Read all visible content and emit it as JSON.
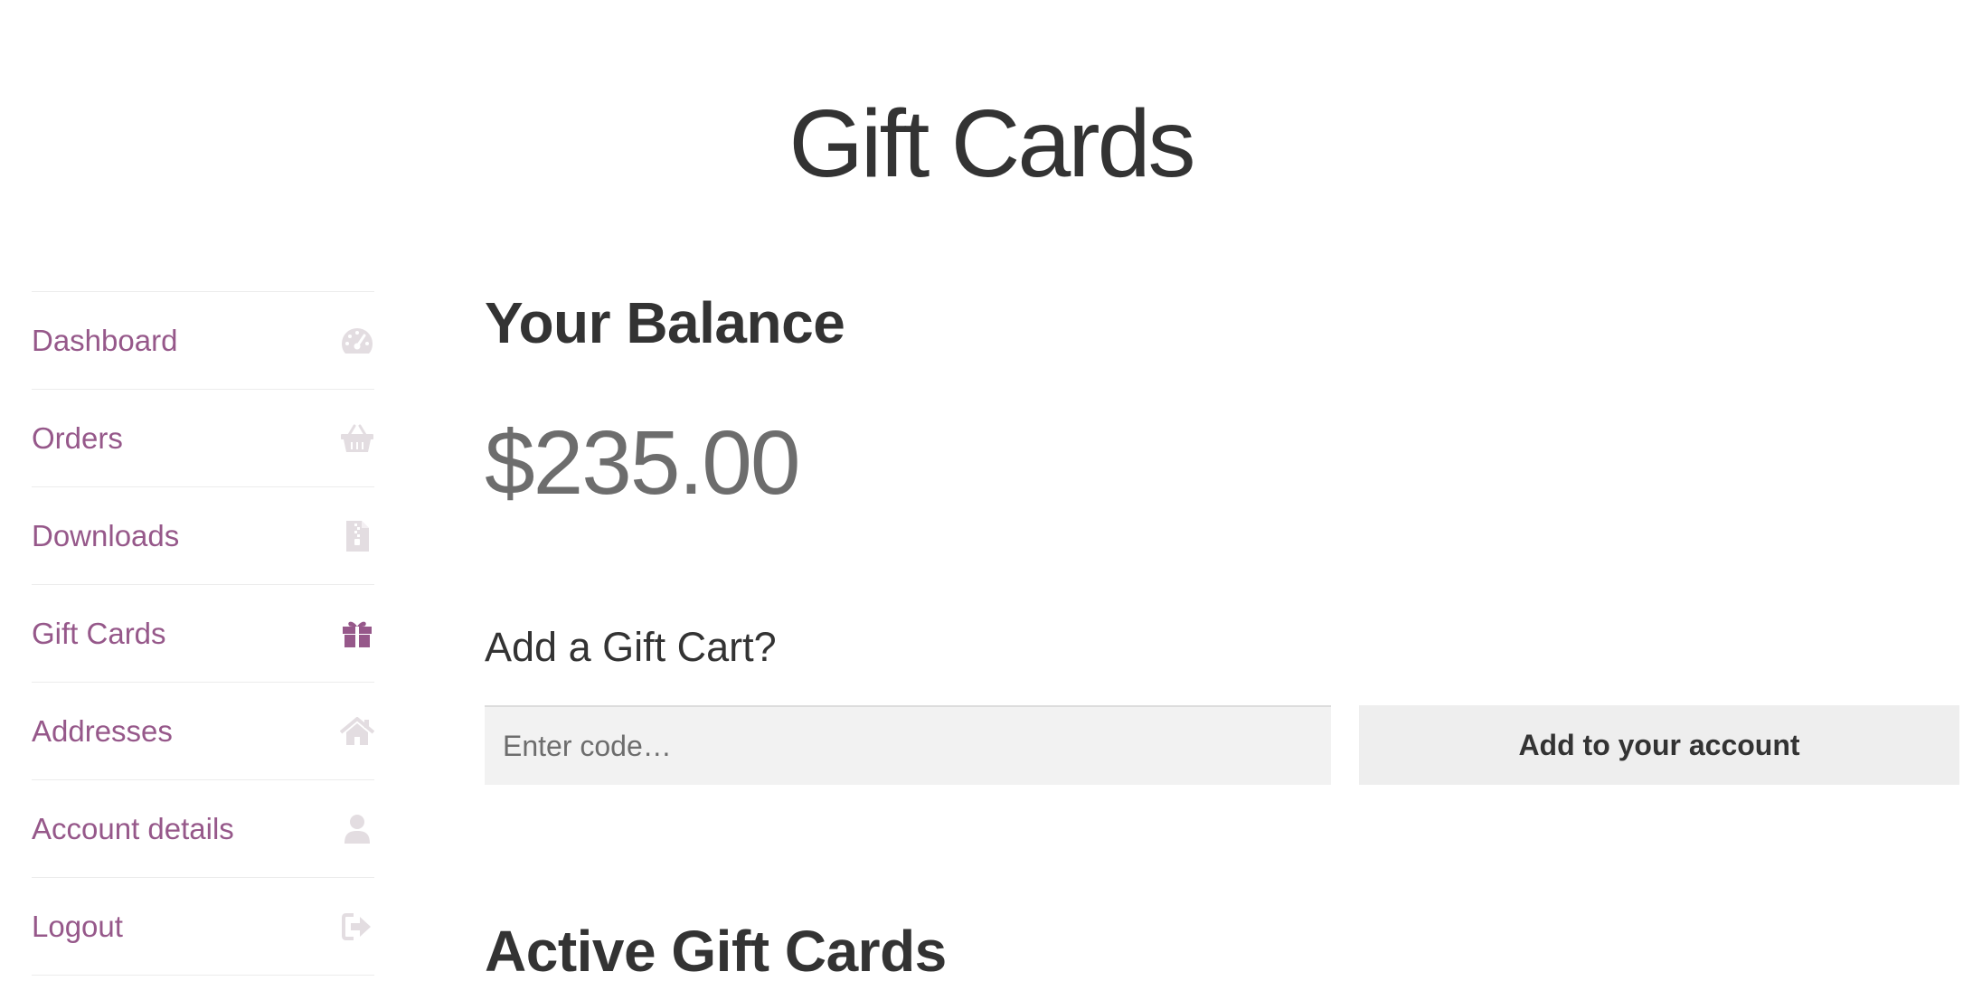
{
  "page": {
    "title": "Gift Cards"
  },
  "nav": {
    "items": [
      {
        "label": "Dashboard",
        "icon": "dashboard-gauge-icon"
      },
      {
        "label": "Orders",
        "icon": "basket-icon"
      },
      {
        "label": "Downloads",
        "icon": "file-archive-icon"
      },
      {
        "label": "Gift Cards",
        "icon": "gift-icon",
        "active": true
      },
      {
        "label": "Addresses",
        "icon": "home-icon"
      },
      {
        "label": "Account details",
        "icon": "user-icon"
      },
      {
        "label": "Logout",
        "icon": "sign-out-icon"
      }
    ]
  },
  "balance": {
    "heading": "Your Balance",
    "amount": "$235.00"
  },
  "redeem": {
    "prompt": "Add a Gift Cart?",
    "placeholder": "Enter code…",
    "button_label": "Add to your account"
  },
  "active_cards": {
    "heading": "Active Gift Cards"
  },
  "colors": {
    "link": "#96588a",
    "icon_muted": "#e3dde1",
    "text": "#333333",
    "amount": "#6d6d6d",
    "input_bg": "#f2f2f2",
    "button_bg": "#eeeeee"
  }
}
